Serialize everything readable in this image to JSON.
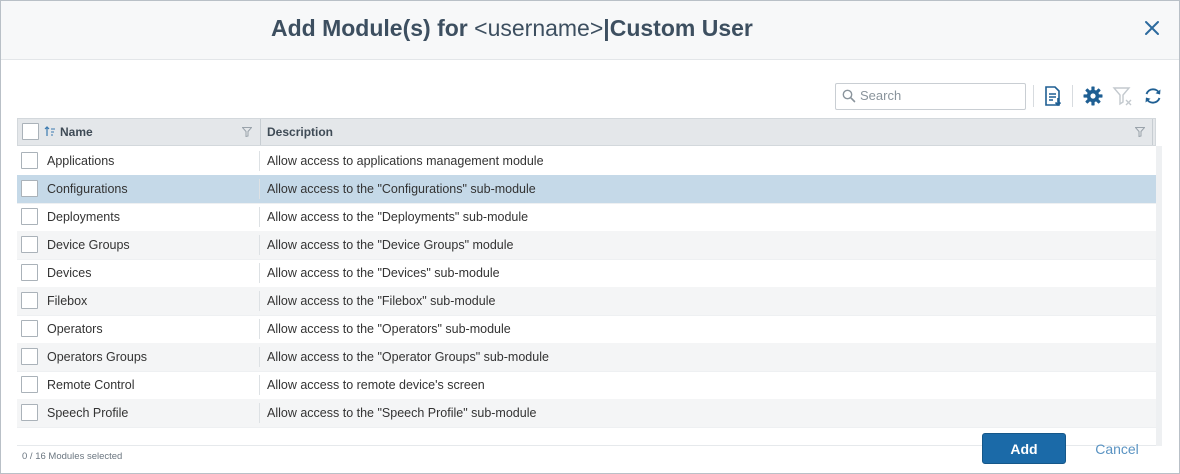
{
  "dialog": {
    "title_prefix": "Add Module(s) for",
    "title_user": "<username>",
    "title_role": "|Custom User"
  },
  "toolbar": {
    "search_placeholder": "Search"
  },
  "grid": {
    "columns": [
      "Name",
      "Description"
    ],
    "rows": [
      {
        "name": "Applications",
        "description": "Allow access to applications management module"
      },
      {
        "name": "Configurations",
        "description": "Allow access to the \"Configurations\" sub-module"
      },
      {
        "name": "Deployments",
        "description": "Allow access to the \"Deployments\" sub-module"
      },
      {
        "name": "Device Groups",
        "description": "Allow access to the \"Device Groups\" module"
      },
      {
        "name": "Devices",
        "description": "Allow access to the \"Devices\" sub-module"
      },
      {
        "name": "Filebox",
        "description": "Allow access to the \"Filebox\" sub-module"
      },
      {
        "name": "Operators",
        "description": "Allow access to the \"Operators\" sub-module"
      },
      {
        "name": "Operators Groups",
        "description": "Allow access to the \"Operator Groups\" sub-module"
      },
      {
        "name": "Remote Control",
        "description": "Allow access to remote device's screen"
      },
      {
        "name": "Speech Profile",
        "description": "Allow access to the \"Speech Profile\" sub-module"
      }
    ]
  },
  "footer": {
    "status": "0 / 16 Modules selected",
    "add_label": "Add",
    "cancel_label": "Cancel"
  },
  "colors": {
    "accent": "#1b6aa8",
    "selected_row": "#c5d9e8",
    "title": "#3d4f60"
  }
}
